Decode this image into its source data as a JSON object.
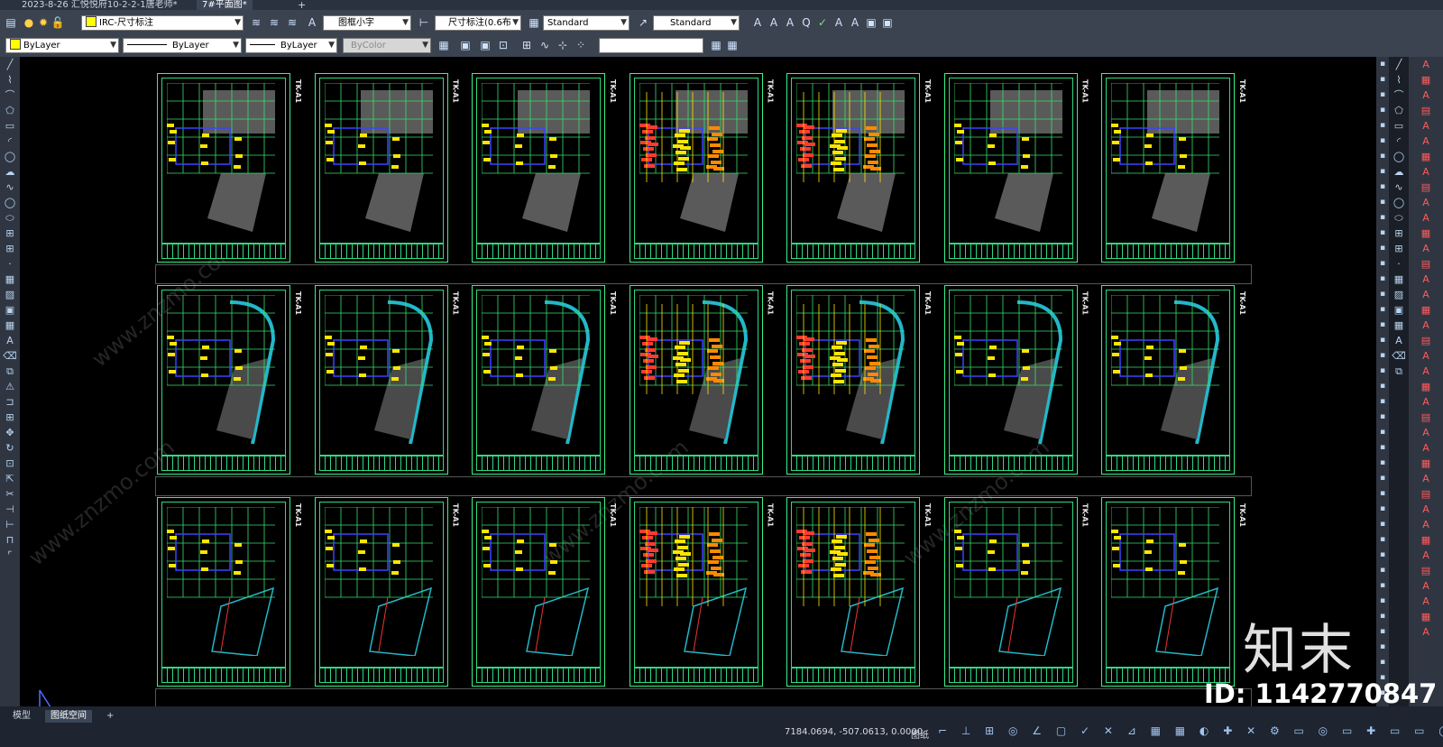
{
  "tabs": [
    {
      "label": "2023-8-26 汇悦悦府10-2-2-1唐老师*",
      "active": false
    },
    {
      "label": "7#平面图*",
      "active": true
    }
  ],
  "toolbar_row1": {
    "layer_name": "IRC-尺寸标注",
    "text_style": "图框小字",
    "dim_style": "尺寸标注(0.6布",
    "table_style": "Standard",
    "multileader_style": "Standard"
  },
  "toolbar_row2": {
    "color": "ByLayer",
    "linetype": "ByLayer",
    "lineweight": "ByLayer",
    "plotstyle": "ByColor",
    "input_value": ""
  },
  "sheets": {
    "code": "TK-A1",
    "rows": 3,
    "cols": 7,
    "row_kinds": [
      "hatched",
      "cyan-curve",
      "lower"
    ],
    "highlight_cols": [
      3,
      4
    ]
  },
  "status": {
    "layout_tabs": [
      {
        "label": "模型",
        "active": false
      },
      {
        "label": "图纸空间",
        "active": true
      }
    ],
    "coords": "7184.0694, -507.0613, 0.0000",
    "mode": "图纸"
  },
  "watermark": {
    "brand": "知末",
    "id": "ID: 1142770847",
    "url": "www.znzmo.com"
  },
  "colors": {
    "sheet_border": "#39f28a",
    "accent_yellow": "#ffff00",
    "ui_dark": "#3b4350"
  },
  "icons": {
    "left": [
      "line-icon",
      "polyline-icon",
      "polygon-icon",
      "rectangle-icon",
      "arc-icon",
      "circle-icon",
      "revcloud-icon",
      "spline-icon",
      "ellipse-icon",
      "insert-icon",
      "block-icon",
      "point-icon",
      "hatch-icon",
      "gradient-icon",
      "region-icon",
      "table-icon",
      "mtext-icon",
      "erase-icon",
      "copy-icon",
      "mirror-icon",
      "offset-icon",
      "array-icon",
      "move-icon",
      "rotate-icon",
      "scale-icon",
      "stretch-icon",
      "trim-icon",
      "extend-icon",
      "break-icon",
      "join-icon",
      "chamfer-icon",
      "fillet-icon",
      "explode-icon"
    ],
    "right": [
      "dim-linear-icon",
      "dim-aligned-icon",
      "dim-arc-icon",
      "dim-ordinate-icon",
      "dim-radius-icon",
      "dim-jogged-icon",
      "dim-diameter-icon",
      "dim-angular-icon",
      "quick-dim-icon",
      "baseline-icon",
      "continue-icon",
      "dimspace-icon",
      "dimbreak-icon",
      "tolerance-icon",
      "center-mark-icon",
      "inspect-icon",
      "jogged-linear-icon",
      "dim-edit-icon",
      "dim-text-edit-icon",
      "dim-update-icon",
      "dim-style-icon"
    ]
  }
}
